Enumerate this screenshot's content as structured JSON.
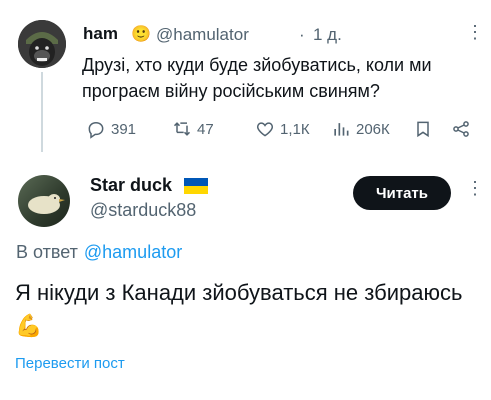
{
  "tweet": {
    "name": "ham",
    "emoji": "🙂",
    "handle": "@hamulator",
    "time_sep": "·",
    "time": "1 д.",
    "more": "⋮",
    "text": "Друзі, хто куди буде зйобуватись, коли ми програєм війну російським свиням?",
    "stats": {
      "replies": "391",
      "retweets": "47",
      "likes": "1,1К",
      "views": "206К"
    },
    "icons": [
      "reply-icon",
      "retweet-icon",
      "like-icon",
      "views-icon",
      "bookmark-icon",
      "share-icon"
    ]
  },
  "reply": {
    "name": "Star duck",
    "flag": "ukraine-flag",
    "handle": "@starduck88",
    "follow_label": "Читать",
    "more": "⋮",
    "reply_to_label": "В ответ",
    "reply_to_handle": "@hamulator",
    "text": "Я нікуди з Канади зйобуваться не збираюсь 💪",
    "translate_label": "Перевести пост"
  },
  "colors": {
    "text": "#0f1419",
    "secondary": "#536471",
    "link": "#1d9bf0",
    "button_bg": "#0f1419",
    "flag_blue": "#0057b7",
    "flag_yellow": "#ffd700"
  }
}
